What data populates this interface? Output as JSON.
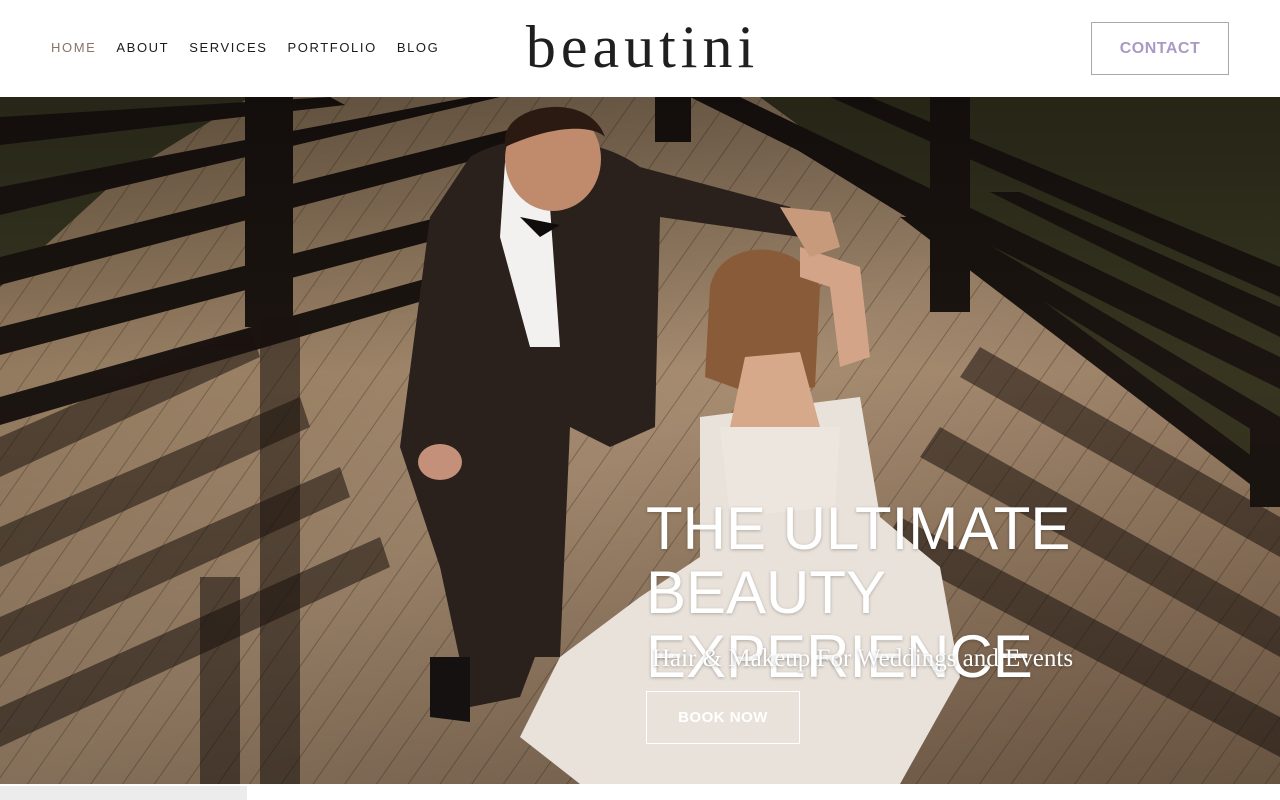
{
  "nav": {
    "items": [
      {
        "label": "HOME",
        "active": true
      },
      {
        "label": "ABOUT"
      },
      {
        "label": "SERVICES"
      },
      {
        "label": "PORTFOLIO"
      },
      {
        "label": "BLOG"
      }
    ]
  },
  "brand": {
    "logo": "beautini"
  },
  "header": {
    "contact_label": "CONTACT"
  },
  "hero": {
    "headline_line1": "THE ULTIMATE",
    "headline_line2": "BEAUTY EXPERIENCE",
    "subhead": "Hair & Makeup For Weddings and Events",
    "cta_label": "BOOK NOW"
  },
  "colors": {
    "nav_active": "#8a7466",
    "contact_text": "#a99ac4",
    "hero_text": "#ffffff"
  }
}
